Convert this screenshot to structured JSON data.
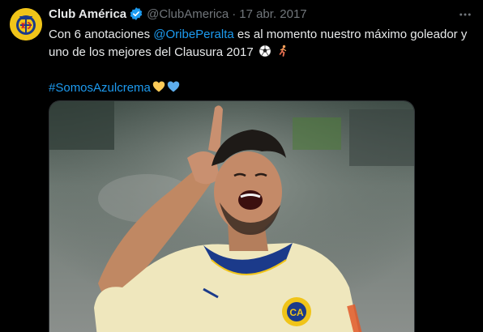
{
  "tweet": {
    "display_name": "Club América",
    "handle": "@ClubAmerica",
    "separator": "·",
    "timestamp": "17 abr. 2017",
    "text_part1": "Con 6 anotaciones ",
    "mention": "@OribePeralta",
    "text_part2": " es al momento nuestro máximo goleador y uno de los mejores del Clausura 2017",
    "hashtag": "#SomosAzulcrema",
    "emojis_line1": [
      "soccer-ball-icon",
      "running-person-icon"
    ],
    "emojis_line2": [
      "yellow-heart-icon",
      "blue-heart-icon"
    ],
    "avatar_icon": "club-america-crest-icon",
    "verified_icon": "verified-badge-icon",
    "more_icon": "more-options-icon"
  },
  "colors": {
    "background": "#000000",
    "text": "#e7e9ea",
    "secondary_text": "#71767b",
    "link": "#1d9bf0",
    "jersey": "#efe7bd",
    "crest_yellow": "#f0c419",
    "crest_blue": "#1b3a8a"
  }
}
